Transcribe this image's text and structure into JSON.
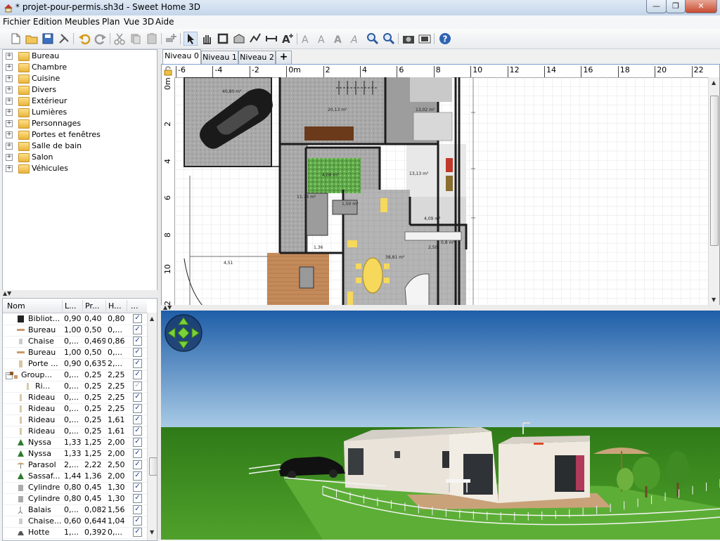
{
  "window": {
    "title": "* projet-pour-permis.sh3d - Sweet Home 3D",
    "minimize": "—",
    "maximize": "❐",
    "close": "✕"
  },
  "menu": [
    "Fichier",
    "Edition",
    "Meubles",
    "Plan",
    "Vue 3D",
    "Aide"
  ],
  "toolbar": {
    "icons": [
      "new-file-icon",
      "open-folder-icon",
      "save-icon",
      "preferences-icon",
      "undo-icon",
      "redo-icon",
      "cut-icon",
      "copy-icon",
      "paste-icon",
      "add-furniture-icon",
      "select-arrow-icon",
      "pan-hand-icon",
      "create-walls-icon",
      "create-rooms-icon",
      "create-polylines-icon",
      "create-dimensions-icon",
      "add-text-icon",
      "text-style-a1-icon",
      "text-style-a2-icon",
      "text-bold-icon",
      "text-italic-icon",
      "zoom-in-icon",
      "zoom-out-icon",
      "create-photo-icon",
      "create-video-icon",
      "help-icon"
    ]
  },
  "catalog": {
    "categories": [
      "Bureau",
      "Chambre",
      "Cuisine",
      "Divers",
      "Extérieur",
      "Lumières",
      "Personnages",
      "Portes et fenêtres",
      "Salle de bain",
      "Salon",
      "Véhicules"
    ],
    "expander": "+"
  },
  "furniture": {
    "columns": [
      "Nom",
      "L...",
      "Pr...",
      "H...",
      "..."
    ],
    "check": "✓",
    "rows": [
      {
        "name": "Bibliot...",
        "w": "0,90",
        "d": "0,40",
        "h": "0,80",
        "visible": true,
        "icon": "bookcase-icon",
        "indent": 1
      },
      {
        "name": "Bureau",
        "w": "1,00",
        "d": "0,50",
        "h": "0,...",
        "visible": true,
        "icon": "desk-icon",
        "indent": 1
      },
      {
        "name": "Chaise",
        "w": "0,...",
        "d": "0,469",
        "h": "0,86",
        "visible": true,
        "icon": "chair-icon",
        "indent": 1
      },
      {
        "name": "Bureau",
        "w": "1,00",
        "d": "0,50",
        "h": "0,...",
        "visible": true,
        "icon": "desk-icon",
        "indent": 1
      },
      {
        "name": "Porte ...",
        "w": "0,90",
        "d": "0,635",
        "h": "2,...",
        "visible": true,
        "icon": "door-icon",
        "indent": 1
      },
      {
        "name": "Group...",
        "w": "0,...",
        "d": "0,25",
        "h": "2,25",
        "visible": true,
        "icon": "group-icon",
        "indent": 0,
        "group": true
      },
      {
        "name": "Ri...",
        "w": "0,...",
        "d": "0,25",
        "h": "2,25",
        "visible": false,
        "icon": "curtain-icon",
        "indent": 2
      },
      {
        "name": "Rideau",
        "w": "0,...",
        "d": "0,25",
        "h": "2,25",
        "visible": true,
        "icon": "curtain-icon",
        "indent": 1
      },
      {
        "name": "Rideau",
        "w": "0,...",
        "d": "0,25",
        "h": "2,25",
        "visible": true,
        "icon": "curtain-icon",
        "indent": 1
      },
      {
        "name": "Rideau",
        "w": "0,...",
        "d": "0,25",
        "h": "1,61",
        "visible": true,
        "icon": "curtain-icon",
        "indent": 1
      },
      {
        "name": "Rideau",
        "w": "0,...",
        "d": "0,25",
        "h": "1,61",
        "visible": true,
        "icon": "curtain-icon",
        "indent": 1
      },
      {
        "name": "Nyssa",
        "w": "1,33",
        "d": "1,25",
        "h": "2,00",
        "visible": true,
        "icon": "tree-icon",
        "indent": 1
      },
      {
        "name": "Nyssa",
        "w": "1,33",
        "d": "1,25",
        "h": "2,00",
        "visible": true,
        "icon": "tree-icon",
        "indent": 1
      },
      {
        "name": "Parasol",
        "w": "2,...",
        "d": "2,22",
        "h": "2,50",
        "visible": true,
        "icon": "parasol-icon",
        "indent": 1
      },
      {
        "name": "Sassaf...",
        "w": "1,44",
        "d": "1,36",
        "h": "2,00",
        "visible": true,
        "icon": "tree-icon",
        "indent": 1
      },
      {
        "name": "Cylindre",
        "w": "0,80",
        "d": "0,45",
        "h": "1,30",
        "visible": true,
        "icon": "cylinder-icon",
        "indent": 1
      },
      {
        "name": "Cylindre",
        "w": "0,80",
        "d": "0,45",
        "h": "1,30",
        "visible": true,
        "icon": "cylinder-icon",
        "indent": 1
      },
      {
        "name": "Balais",
        "w": "0,...",
        "d": "0,082",
        "h": "1,56",
        "visible": true,
        "icon": "broom-icon",
        "indent": 1
      },
      {
        "name": "Chaise...",
        "w": "0,60",
        "d": "0,644",
        "h": "1,04",
        "visible": true,
        "icon": "chair-icon",
        "indent": 1
      },
      {
        "name": "Hotte",
        "w": "1,...",
        "d": "0,392",
        "h": "0,...",
        "visible": true,
        "icon": "hood-icon",
        "indent": 1
      }
    ]
  },
  "levels": {
    "tabs": [
      "Niveau 0",
      "Niveau 1",
      "Niveau 2"
    ],
    "active": 0,
    "add": "+"
  },
  "plan": {
    "hruler": [
      "-6",
      "-4",
      "-2",
      "0m",
      "2",
      "4",
      "6",
      "8",
      "10",
      "12",
      "14",
      "16",
      "18",
      "20",
      "22"
    ],
    "vruler": [
      "0m",
      "2",
      "4",
      "6",
      "8",
      "10",
      "12"
    ],
    "rooms": [
      {
        "label": "40,80 m²"
      },
      {
        "label": "20,13 m²"
      },
      {
        "label": "13,02 m²"
      },
      {
        "label": "13,13 m²"
      },
      {
        "label": "4,09 m²"
      },
      {
        "label": "11,74 m²"
      },
      {
        "label": "1,50 m²"
      },
      {
        "label": "4,09 m²"
      },
      {
        "label": "0,8 m²"
      },
      {
        "label": "38,81 m²"
      }
    ],
    "dims": [
      "4,51",
      "2,50",
      "1,36"
    ]
  },
  "colors": {
    "accent": "#7ea3cf",
    "sky_top": "#1f5ea8",
    "sky_bottom": "#a9cbe6",
    "grass": "#3f8a1f"
  }
}
